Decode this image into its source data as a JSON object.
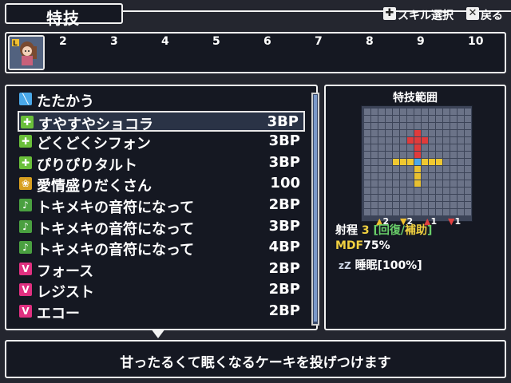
{
  "header": {
    "title": "特技",
    "skill_select_label": "スキル選択",
    "back_label": "戻る"
  },
  "party": {
    "slots": [
      "2",
      "3",
      "4",
      "5",
      "6",
      "7",
      "8",
      "9",
      "10"
    ]
  },
  "skills": [
    {
      "name": "たたかう",
      "cost": "",
      "icon": "sword-icon",
      "color": "#4aa8e8"
    },
    {
      "name": "すやすやショコラ",
      "cost": "3BP",
      "icon": "plus-icon",
      "color": "#6abf3a"
    },
    {
      "name": "どくどくシフォン",
      "cost": "3BP",
      "icon": "plus-icon",
      "color": "#6abf3a"
    },
    {
      "name": "ぴりぴりタルト",
      "cost": "3BP",
      "icon": "plus-icon",
      "color": "#6abf3a"
    },
    {
      "name": "愛情盛りだくさん",
      "cost": "100",
      "icon": "heart-icon",
      "color": "#d8a020"
    },
    {
      "name": "トキメキの音符になって",
      "cost": "2BP",
      "icon": "note-icon",
      "color": "#4aa040"
    },
    {
      "name": "トキメキの音符になって",
      "cost": "3BP",
      "icon": "note-icon",
      "color": "#4aa040"
    },
    {
      "name": "トキメキの音符になって",
      "cost": "4BP",
      "icon": "note-icon",
      "color": "#4aa040"
    },
    {
      "name": "フォース",
      "cost": "2BP",
      "icon": "voice-icon",
      "color": "#e03080"
    },
    {
      "name": "レジスト",
      "cost": "2BP",
      "icon": "voice-icon",
      "color": "#e03080"
    },
    {
      "name": "エコー",
      "cost": "2BP",
      "icon": "voice-icon",
      "color": "#e03080"
    }
  ],
  "selected_index": 1,
  "range": {
    "title": "特技範囲",
    "modifiers": [
      "2",
      "2",
      "1",
      "1"
    ],
    "range_label": "射程",
    "range_value": "3",
    "range_type_open": "[",
    "range_type_heal": "回復",
    "range_type_sep": "/",
    "range_type_support": "補助",
    "range_type_close": "]",
    "mdf_label": "MDF",
    "mdf_value": "75%",
    "status_effect": "睡眠[100%]"
  },
  "help": {
    "text": "甘ったるくて眠くなるケーキを投げつけます"
  }
}
